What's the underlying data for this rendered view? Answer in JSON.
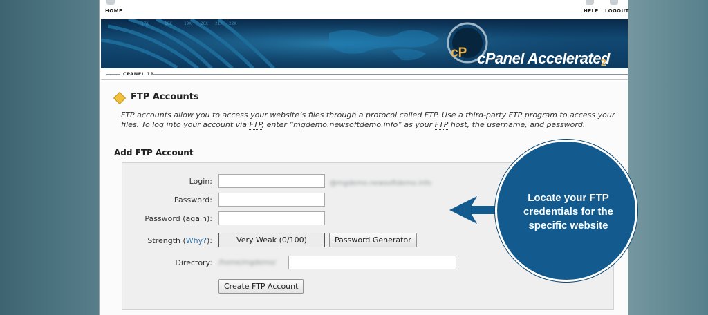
{
  "topbar": {
    "home_label": "HOME",
    "help_label": "HELP",
    "logout_label": "LOGOUT"
  },
  "banner": {
    "logo_mark": "cP",
    "logo_main": "cPanel Accelerated",
    "logo_suffix": "2"
  },
  "subnav": {
    "label": "CPANEL 11"
  },
  "page": {
    "title": "FTP Accounts",
    "desc_abbr": "FTP",
    "desc_part1": " accounts allow you to access your website’s files through a protocol called FTP. Use a third-party ",
    "desc_part2": " program to access your files. To log into your account via ",
    "desc_part3": ", enter “mgdemo.newsoftdemo.info” as your ",
    "desc_part4": " host, the username, and password.",
    "section_heading": "Add FTP Account"
  },
  "form": {
    "login_label": "Login:",
    "login_value": "",
    "domain_suffix": "@mgdemo.newsoftdemo.info",
    "password_label": "Password:",
    "password_value": "",
    "password_again_label": "Password (again):",
    "password_again_value": "",
    "strength_label": "Strength (",
    "strength_why": "Why?",
    "strength_label_end": "):",
    "strength_value": "Very Weak (0/100)",
    "generator_button": "Password Generator",
    "directory_label": "Directory:",
    "directory_prefix": "/home/mgdemo/",
    "directory_value": "",
    "create_button": "Create FTP Account"
  },
  "callout": {
    "text": "Locate your FTP credentials for the specific website"
  },
  "colors": {
    "callout": "#135a8f",
    "link": "#2d6ea3",
    "banner": "#0c3a60"
  }
}
